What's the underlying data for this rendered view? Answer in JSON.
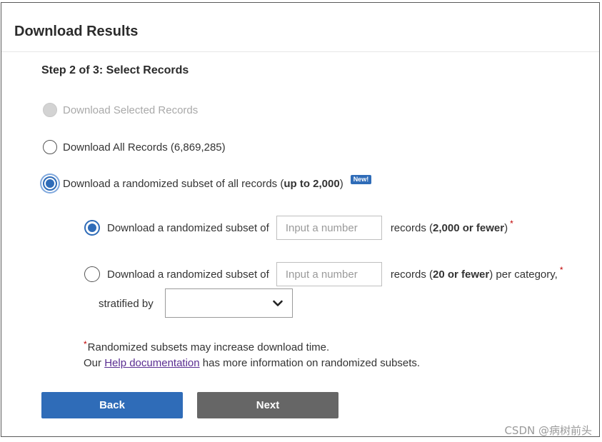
{
  "dialog": {
    "title": "Download Results",
    "step": "Step 2 of 3: Select Records"
  },
  "options": {
    "selected_records": "Download Selected Records",
    "all_records_prefix": "Download All Records ",
    "all_records_count": "(6,869,285)",
    "random_subset_prefix": "Download a randomized subset of all records (",
    "random_subset_bold": "up to 2,000",
    "random_subset_suffix": ")",
    "new_badge": "New!"
  },
  "suboptions": {
    "simple_prefix": "Download a randomized subset of",
    "simple_placeholder": "Input a number",
    "simple_suffix_1": "records (",
    "simple_suffix_bold": "2,000 or fewer",
    "simple_suffix_2": ")",
    "stratified_prefix": "Download a randomized subset of",
    "stratified_placeholder": "Input a number",
    "stratified_suffix_1": "records (",
    "stratified_suffix_bold": "20 or fewer",
    "stratified_suffix_2": ") per category,",
    "stratified_by_label": "stratified by",
    "stratified_by_value": "",
    "required_mark": "*"
  },
  "notes": {
    "asterisk": "*",
    "line1": "Randomized subsets may increase download time.",
    "line2_prefix": "Our ",
    "help_link": "Help documentation",
    "line2_suffix": " has more information on randomized subsets."
  },
  "buttons": {
    "back": "Back",
    "next": "Next"
  },
  "watermark": "CSDN @病树前头",
  "colors": {
    "primary": "#2f6cb8",
    "next_button": "#666666",
    "required": "#c00000",
    "link": "#5a2d91"
  }
}
